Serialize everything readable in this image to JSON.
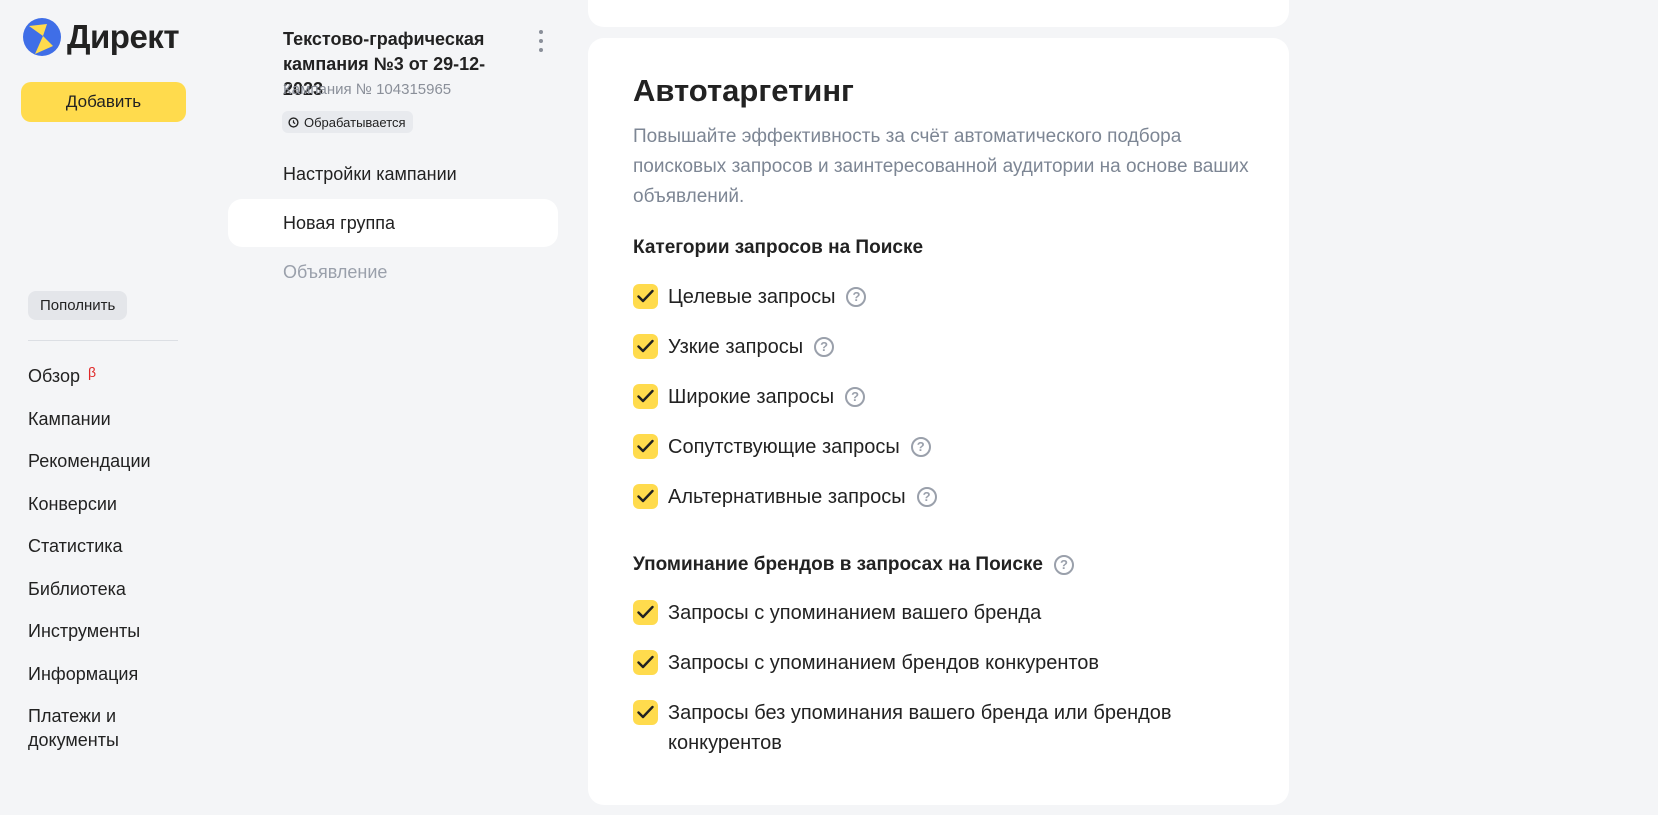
{
  "brand": {
    "name": "Директ"
  },
  "left_nav": {
    "add_label": "Добавить",
    "topup_label": "Пополнить",
    "beta_mark": "β",
    "items": [
      {
        "label": "Обзор"
      },
      {
        "label": "Кампании"
      },
      {
        "label": "Рекомендации"
      },
      {
        "label": "Конверсии"
      },
      {
        "label": "Статистика"
      },
      {
        "label": "Библиотека"
      },
      {
        "label": "Инструменты"
      },
      {
        "label": "Информация"
      },
      {
        "label": "Платежи и документы"
      }
    ]
  },
  "campaign": {
    "title": "Текстово-графическая кампания №3 от 29-12-2023",
    "number": "Кампания № 104315965",
    "status": "Обрабатывается",
    "nav": [
      {
        "label": "Настройки кампании"
      },
      {
        "label": "Новая группа"
      },
      {
        "label": "Объявление"
      }
    ]
  },
  "autotargeting": {
    "title": "Автотаргетинг",
    "description": "Повышайте эффективность за счёт автоматического подбора поисковых запросов и заинтересованной аудитории на основе ваших объявлений.",
    "categories_title": "Категории запросов на Поиске",
    "categories": [
      {
        "label": "Целевые запросы",
        "checked": true
      },
      {
        "label": "Узкие запросы",
        "checked": true
      },
      {
        "label": "Широкие запросы",
        "checked": true
      },
      {
        "label": "Сопутствующие запросы",
        "checked": true
      },
      {
        "label": "Альтернативные запросы",
        "checked": true
      }
    ],
    "brands_title": "Упоминание брендов в запросах на Поиске",
    "brands": [
      {
        "label": "Запросы с упоминанием вашего бренда",
        "checked": true
      },
      {
        "label": "Запросы с упоминанием брендов конкурентов",
        "checked": true
      },
      {
        "label": "Запросы без упоминания вашего бренда или брендов конкурентов",
        "checked": true
      }
    ]
  },
  "colors": {
    "accent_yellow": "#ffdb4d",
    "logo_blue": "#3f6ee7",
    "beta_red": "#e02929"
  },
  "icons": {
    "logo": "direct-logo-icon",
    "more": "more-vertical-icon",
    "status": "clock-icon",
    "help": "help-icon",
    "check": "check-icon"
  }
}
